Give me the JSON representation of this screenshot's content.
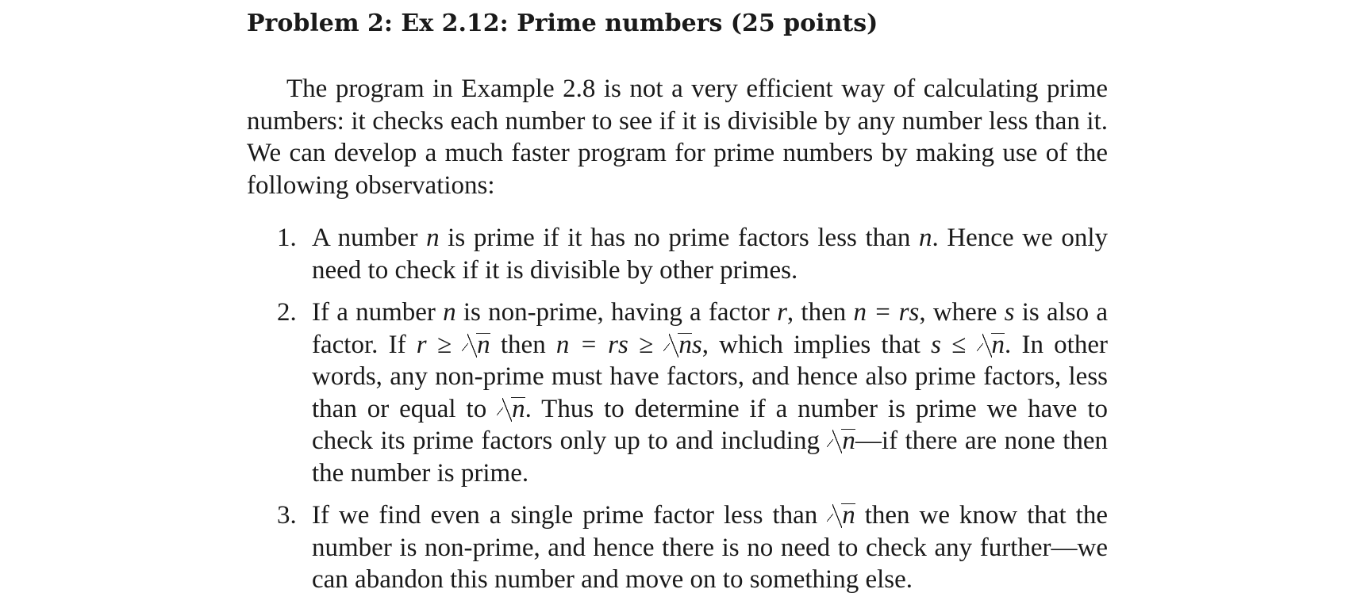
{
  "problem": {
    "title": "Problem 2: Ex 2.12: Prime numbers (25 points)"
  },
  "intro": {
    "text": "The program in Example 2.8 is not a very efficient way of calculating prime numbers: it checks each number to see if it is divisible by any number less than it. We can develop a much faster program for prime numbers by making use of the following observations:"
  },
  "observations": [
    {
      "number": "1.",
      "parts": [
        "A number ",
        "n",
        " is prime if it has no prime factors less than ",
        "n",
        ". Hence we only need to check if it is divisible by other primes."
      ]
    },
    {
      "number": "2.",
      "parts": [
        "If a number ",
        "n",
        " is non-prime, having a factor ",
        "r",
        ", then ",
        "n = rs",
        ", where ",
        "s",
        " is also a factor. If ",
        "r ≥ ",
        "n",
        " then ",
        "n = rs ≥ ",
        "n",
        "s",
        ", which implies that ",
        "s ≤ ",
        "n",
        ". In other words, any non-prime must have factors, and hence also prime factors, less than or equal to ",
        "n",
        ". Thus to determine if a number is prime we have to check its prime factors only up to and including ",
        "n",
        "—if there are none then the number is prime."
      ]
    },
    {
      "number": "3.",
      "parts": [
        "If we find even a single prime factor less than ",
        "n",
        " then we know that the number is non-prime, and hence there is no need to check any further—we can abandon this number and move on to something else."
      ]
    }
  ]
}
